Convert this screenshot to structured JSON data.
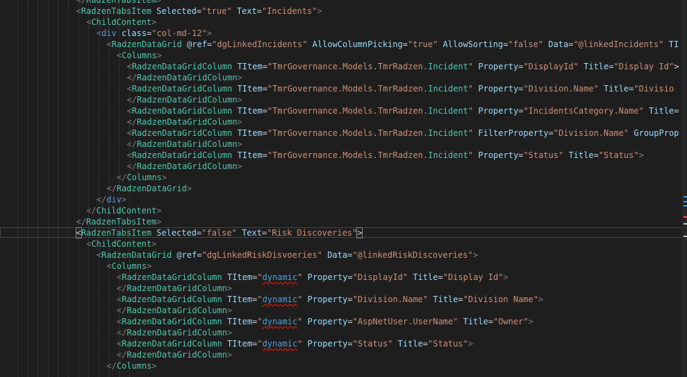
{
  "editor": {
    "lines": [
      {
        "indent": 6,
        "parts": [
          [
            "tb",
            "</"
          ],
          [
            "tn",
            "RadzenTabsItem"
          ],
          [
            "tb",
            ">"
          ]
        ]
      },
      {
        "indent": 6,
        "parts": [
          [
            "tb",
            "<"
          ],
          [
            "tn",
            "RadzenTabsItem"
          ],
          [
            "t",
            " "
          ],
          [
            "an",
            "Selected"
          ],
          [
            "t",
            "="
          ],
          [
            "av",
            "\"true\""
          ],
          [
            "t",
            " "
          ],
          [
            "an",
            "Text"
          ],
          [
            "t",
            "="
          ],
          [
            "av",
            "\"Incidents\""
          ],
          [
            "tb",
            ">"
          ]
        ]
      },
      {
        "indent": 7,
        "parts": [
          [
            "tb",
            "<"
          ],
          [
            "tn",
            "ChildContent"
          ],
          [
            "tb",
            ">"
          ]
        ]
      },
      {
        "indent": 8,
        "parts": [
          [
            "tb",
            "<"
          ],
          [
            "th",
            "div"
          ],
          [
            "t",
            " "
          ],
          [
            "an",
            "class"
          ],
          [
            "t",
            "="
          ],
          [
            "av",
            "\"col-md-12\""
          ],
          [
            "tb",
            ">"
          ]
        ]
      },
      {
        "indent": 9,
        "parts": [
          [
            "tb",
            "<"
          ],
          [
            "tn",
            "RadzenDataGrid"
          ],
          [
            "t",
            " "
          ],
          [
            "an",
            "@ref"
          ],
          [
            "t",
            "="
          ],
          [
            "av",
            "\"dgLinkedIncidents\""
          ],
          [
            "t",
            " "
          ],
          [
            "an",
            "AllowColumnPicking"
          ],
          [
            "t",
            "="
          ],
          [
            "av",
            "\"true\""
          ],
          [
            "t",
            " "
          ],
          [
            "an",
            "AllowSorting"
          ],
          [
            "t",
            "="
          ],
          [
            "av",
            "\"false\""
          ],
          [
            "t",
            " "
          ],
          [
            "an",
            "Data"
          ],
          [
            "t",
            "="
          ],
          [
            "av",
            "\"@linkedIncidents\""
          ],
          [
            "t",
            " "
          ],
          [
            "an",
            "TI"
          ]
        ]
      },
      {
        "indent": 10,
        "parts": [
          [
            "tb",
            "<"
          ],
          [
            "tn",
            "Columns"
          ],
          [
            "tb",
            ">"
          ]
        ]
      },
      {
        "indent": 11,
        "parts": [
          [
            "tb",
            "<"
          ],
          [
            "tn",
            "RadzenDataGridColumn"
          ],
          [
            "t",
            " "
          ],
          [
            "an",
            "TItem"
          ],
          [
            "t",
            "="
          ],
          [
            "av",
            "\"TmrGovernance.Models.TmrRadzen."
          ],
          [
            "tn",
            "Incident"
          ],
          [
            "av",
            "\""
          ],
          [
            "t",
            " "
          ],
          [
            "an",
            "Property"
          ],
          [
            "t",
            "="
          ],
          [
            "av",
            "\"DisplayId\""
          ],
          [
            "t",
            " "
          ],
          [
            "an",
            "Title"
          ],
          [
            "t",
            "="
          ],
          [
            "av",
            "\"Display Id\""
          ],
          [
            "t",
            ">"
          ]
        ]
      },
      {
        "indent": 11,
        "parts": [
          [
            "tb",
            "</"
          ],
          [
            "tn",
            "RadzenDataGridColumn"
          ],
          [
            "tb",
            ">"
          ]
        ]
      },
      {
        "indent": 11,
        "parts": [
          [
            "tb",
            "<"
          ],
          [
            "tn",
            "RadzenDataGridColumn"
          ],
          [
            "t",
            " "
          ],
          [
            "an",
            "TItem"
          ],
          [
            "t",
            "="
          ],
          [
            "av",
            "\"TmrGovernance.Models.TmrRadzen."
          ],
          [
            "tn",
            "Incident"
          ],
          [
            "av",
            "\""
          ],
          [
            "t",
            " "
          ],
          [
            "an",
            "Property"
          ],
          [
            "t",
            "="
          ],
          [
            "av",
            "\"Division.Name\""
          ],
          [
            "t",
            " "
          ],
          [
            "an",
            "Title"
          ],
          [
            "t",
            "="
          ],
          [
            "av",
            "\"Divisio"
          ]
        ]
      },
      {
        "indent": 11,
        "parts": [
          [
            "tb",
            "</"
          ],
          [
            "tn",
            "RadzenDataGridColumn"
          ],
          [
            "tb",
            ">"
          ]
        ]
      },
      {
        "indent": 11,
        "parts": [
          [
            "tb",
            "<"
          ],
          [
            "tn",
            "RadzenDataGridColumn"
          ],
          [
            "t",
            " "
          ],
          [
            "an",
            "TItem"
          ],
          [
            "t",
            "="
          ],
          [
            "av",
            "\"TmrGovernance.Models.TmrRadzen."
          ],
          [
            "tn",
            "Incident"
          ],
          [
            "av",
            "\""
          ],
          [
            "t",
            " "
          ],
          [
            "an",
            "Property"
          ],
          [
            "t",
            "="
          ],
          [
            "av",
            "\"IncidentsCategory.Name\""
          ],
          [
            "t",
            " "
          ],
          [
            "an",
            "Title"
          ],
          [
            "t",
            "="
          ]
        ]
      },
      {
        "indent": 11,
        "parts": [
          [
            "tb",
            "</"
          ],
          [
            "tn",
            "RadzenDataGridColumn"
          ],
          [
            "tb",
            ">"
          ]
        ]
      },
      {
        "indent": 11,
        "parts": [
          [
            "tb",
            "<"
          ],
          [
            "tn",
            "RadzenDataGridColumn"
          ],
          [
            "t",
            " "
          ],
          [
            "an",
            "TItem"
          ],
          [
            "t",
            "="
          ],
          [
            "av",
            "\"TmrGovernance.Models.TmrRadzen."
          ],
          [
            "tn",
            "Incident"
          ],
          [
            "av",
            "\""
          ],
          [
            "t",
            " "
          ],
          [
            "an",
            "FilterProperty"
          ],
          [
            "t",
            "="
          ],
          [
            "av",
            "\"Division.Name\""
          ],
          [
            "t",
            " "
          ],
          [
            "an",
            "GroupProp"
          ]
        ]
      },
      {
        "indent": 11,
        "parts": [
          [
            "tb",
            "</"
          ],
          [
            "tn",
            "RadzenDataGridColumn"
          ],
          [
            "tb",
            ">"
          ]
        ]
      },
      {
        "indent": 11,
        "parts": [
          [
            "tb",
            "<"
          ],
          [
            "tn",
            "RadzenDataGridColumn"
          ],
          [
            "t",
            " "
          ],
          [
            "an",
            "TItem"
          ],
          [
            "t",
            "="
          ],
          [
            "av",
            "\"TmrGovernance.Models.TmrRadzen."
          ],
          [
            "tn",
            "Incident"
          ],
          [
            "av",
            "\""
          ],
          [
            "t",
            " "
          ],
          [
            "an",
            "Property"
          ],
          [
            "t",
            "="
          ],
          [
            "av",
            "\"Status\""
          ],
          [
            "t",
            " "
          ],
          [
            "an",
            "Title"
          ],
          [
            "t",
            "="
          ],
          [
            "av",
            "\"Status\""
          ],
          [
            "tb",
            ">"
          ]
        ]
      },
      {
        "indent": 11,
        "parts": [
          [
            "tb",
            "</"
          ],
          [
            "tn",
            "RadzenDataGridColumn"
          ],
          [
            "tb",
            ">"
          ]
        ]
      },
      {
        "indent": 10,
        "parts": [
          [
            "tb",
            "</"
          ],
          [
            "tn",
            "Columns"
          ],
          [
            "tb",
            ">"
          ]
        ]
      },
      {
        "indent": 9,
        "parts": [
          [
            "tb",
            "</"
          ],
          [
            "tn",
            "RadzenDataGrid"
          ],
          [
            "tb",
            ">"
          ]
        ]
      },
      {
        "indent": 8,
        "parts": [
          [
            "tb",
            "</"
          ],
          [
            "th",
            "div"
          ],
          [
            "tb",
            ">"
          ]
        ]
      },
      {
        "indent": 7,
        "parts": [
          [
            "tb",
            "</"
          ],
          [
            "tn",
            "ChildContent"
          ],
          [
            "tb",
            ">"
          ]
        ]
      },
      {
        "indent": 6,
        "parts": [
          [
            "tb",
            "</"
          ],
          [
            "tn",
            "RadzenTabsItem"
          ],
          [
            "tb",
            ">"
          ]
        ]
      },
      {
        "indent": 6,
        "highlight": true,
        "parts": [
          [
            "bm",
            "<"
          ],
          [
            "tn",
            "RadzenTabsItem"
          ],
          [
            "t",
            " "
          ],
          [
            "an",
            "Selected"
          ],
          [
            "t",
            "="
          ],
          [
            "av",
            "\"false\""
          ],
          [
            "t",
            " "
          ],
          [
            "an",
            "Text"
          ],
          [
            "t",
            "="
          ],
          [
            "av",
            "\"Risk Discoveries\""
          ],
          [
            "bm",
            ">"
          ]
        ]
      },
      {
        "indent": 7,
        "parts": [
          [
            "tb",
            "<"
          ],
          [
            "tn",
            "ChildContent"
          ],
          [
            "tb",
            ">"
          ]
        ]
      },
      {
        "indent": 8,
        "parts": [
          [
            "tb",
            "<"
          ],
          [
            "tn",
            "RadzenDataGrid"
          ],
          [
            "t",
            " "
          ],
          [
            "an",
            "@ref"
          ],
          [
            "t",
            "="
          ],
          [
            "av",
            "\"dgLinkedRiskDisvoeries\""
          ],
          [
            "t",
            " "
          ],
          [
            "an",
            "Data"
          ],
          [
            "t",
            "="
          ],
          [
            "av",
            "\"@linkedRiskDiscoveries\""
          ],
          [
            "tb",
            ">"
          ]
        ]
      },
      {
        "indent": 9,
        "parts": [
          [
            "tb",
            "<"
          ],
          [
            "tn",
            "Columns"
          ],
          [
            "tb",
            ">"
          ]
        ]
      },
      {
        "indent": 10,
        "parts": [
          [
            "tb",
            "<"
          ],
          [
            "tn",
            "RadzenDataGridColumn"
          ],
          [
            "t",
            " "
          ],
          [
            "an",
            "TItem"
          ],
          [
            "t",
            "="
          ],
          [
            "av",
            "\""
          ],
          [
            "kw",
            "dynamic"
          ],
          [
            "av",
            "\""
          ],
          [
            "t",
            " "
          ],
          [
            "an",
            "Property"
          ],
          [
            "t",
            "="
          ],
          [
            "av",
            "\"DisplayId\""
          ],
          [
            "t",
            " "
          ],
          [
            "an",
            "Title"
          ],
          [
            "t",
            "="
          ],
          [
            "av",
            "\"Display Id\""
          ],
          [
            "tb",
            ">"
          ]
        ]
      },
      {
        "indent": 10,
        "parts": [
          [
            "tb",
            "</"
          ],
          [
            "tn",
            "RadzenDataGridColumn"
          ],
          [
            "tb",
            ">"
          ]
        ]
      },
      {
        "indent": 10,
        "parts": [
          [
            "tb",
            "<"
          ],
          [
            "tn",
            "RadzenDataGridColumn"
          ],
          [
            "t",
            " "
          ],
          [
            "an",
            "TItem"
          ],
          [
            "t",
            "="
          ],
          [
            "av",
            "\""
          ],
          [
            "kw",
            "dynamic"
          ],
          [
            "av",
            "\""
          ],
          [
            "t",
            " "
          ],
          [
            "an",
            "Property"
          ],
          [
            "t",
            "="
          ],
          [
            "av",
            "\"Division.Name\""
          ],
          [
            "t",
            " "
          ],
          [
            "an",
            "Title"
          ],
          [
            "t",
            "="
          ],
          [
            "av",
            "\"Division Name\""
          ],
          [
            "tb",
            ">"
          ]
        ]
      },
      {
        "indent": 10,
        "parts": [
          [
            "tb",
            "</"
          ],
          [
            "tn",
            "RadzenDataGridColumn"
          ],
          [
            "tb",
            ">"
          ]
        ]
      },
      {
        "indent": 10,
        "parts": [
          [
            "tb",
            "<"
          ],
          [
            "tn",
            "RadzenDataGridColumn"
          ],
          [
            "t",
            " "
          ],
          [
            "an",
            "TItem"
          ],
          [
            "t",
            "="
          ],
          [
            "av",
            "\""
          ],
          [
            "kw",
            "dynamic"
          ],
          [
            "av",
            "\""
          ],
          [
            "t",
            " "
          ],
          [
            "an",
            "Property"
          ],
          [
            "t",
            "="
          ],
          [
            "av",
            "\"AspNetUser.UserName\""
          ],
          [
            "t",
            " "
          ],
          [
            "an",
            "Title"
          ],
          [
            "t",
            "="
          ],
          [
            "av",
            "\"Owner\""
          ],
          [
            "tb",
            ">"
          ]
        ]
      },
      {
        "indent": 10,
        "parts": [
          [
            "tb",
            "</"
          ],
          [
            "tn",
            "RadzenDataGridColumn"
          ],
          [
            "tb",
            ">"
          ]
        ]
      },
      {
        "indent": 10,
        "parts": [
          [
            "tb",
            "<"
          ],
          [
            "tn",
            "RadzenDataGridColumn"
          ],
          [
            "t",
            " "
          ],
          [
            "an",
            "TItem"
          ],
          [
            "t",
            "="
          ],
          [
            "av",
            "\""
          ],
          [
            "kw",
            "dynamic"
          ],
          [
            "av",
            "\""
          ],
          [
            "t",
            " "
          ],
          [
            "an",
            "Property"
          ],
          [
            "t",
            "="
          ],
          [
            "av",
            "\"Status\""
          ],
          [
            "t",
            " "
          ],
          [
            "an",
            "Title"
          ],
          [
            "t",
            "="
          ],
          [
            "av",
            "\"Status\""
          ],
          [
            "tb",
            ">"
          ]
        ]
      },
      {
        "indent": 10,
        "parts": [
          [
            "tb",
            "</"
          ],
          [
            "tn",
            "RadzenDataGridColumn"
          ],
          [
            "tb",
            ">"
          ]
        ]
      },
      {
        "indent": 9,
        "parts": [
          [
            "tb",
            "</"
          ],
          [
            "tn",
            "Columns"
          ],
          [
            "tb",
            ">"
          ]
        ]
      }
    ]
  }
}
